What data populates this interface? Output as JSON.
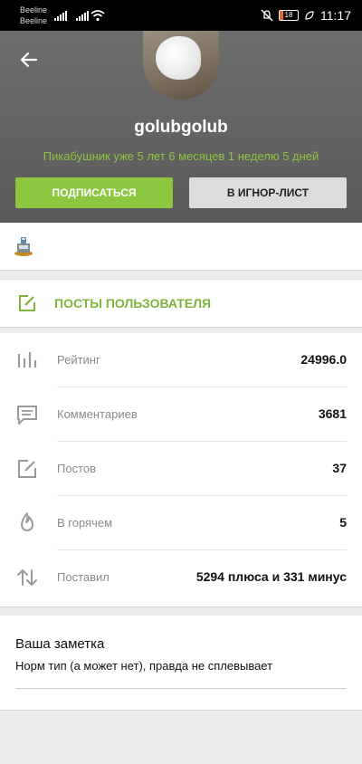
{
  "status_bar": {
    "carrier1": "Beeline",
    "carrier2": "Beeline",
    "battery": "18",
    "time": "11:17",
    "icons": [
      "signal-icon",
      "signal-icon",
      "wifi-icon",
      "mute-icon",
      "battery-icon",
      "leaf-icon"
    ]
  },
  "header": {
    "back_icon": "arrow-left-icon",
    "username": "golubgolub",
    "member_since": "Пикабушник уже 5 лет 6 месяцев 1 неделю 5 дней",
    "subscribe_label": "Подписаться",
    "ignore_label": "В игнор-лист"
  },
  "awards": {
    "icon": "award-icon"
  },
  "posts_link": {
    "label": "Посты пользователя",
    "icon": "edit-square-icon"
  },
  "stats": [
    {
      "icon": "chart-bars-icon",
      "label": "Рейтинг",
      "value": "24996.0"
    },
    {
      "icon": "comment-icon",
      "label": "Комментариев",
      "value": "3681"
    },
    {
      "icon": "edit-square-icon",
      "label": "Постов",
      "value": "37"
    },
    {
      "icon": "flame-icon",
      "label": "В горячем",
      "value": "5"
    },
    {
      "icon": "arrows-updown-icon",
      "label": "Поставил",
      "value": "5294 плюса и 331 минус"
    }
  ],
  "note": {
    "title": "Ваша заметка",
    "text": "Норм тип (а может нет), правда не сплевывает"
  },
  "colors": {
    "accent": "#8dc63f",
    "header_bg": "#666666",
    "ignore_bg": "#dcdcdc"
  }
}
